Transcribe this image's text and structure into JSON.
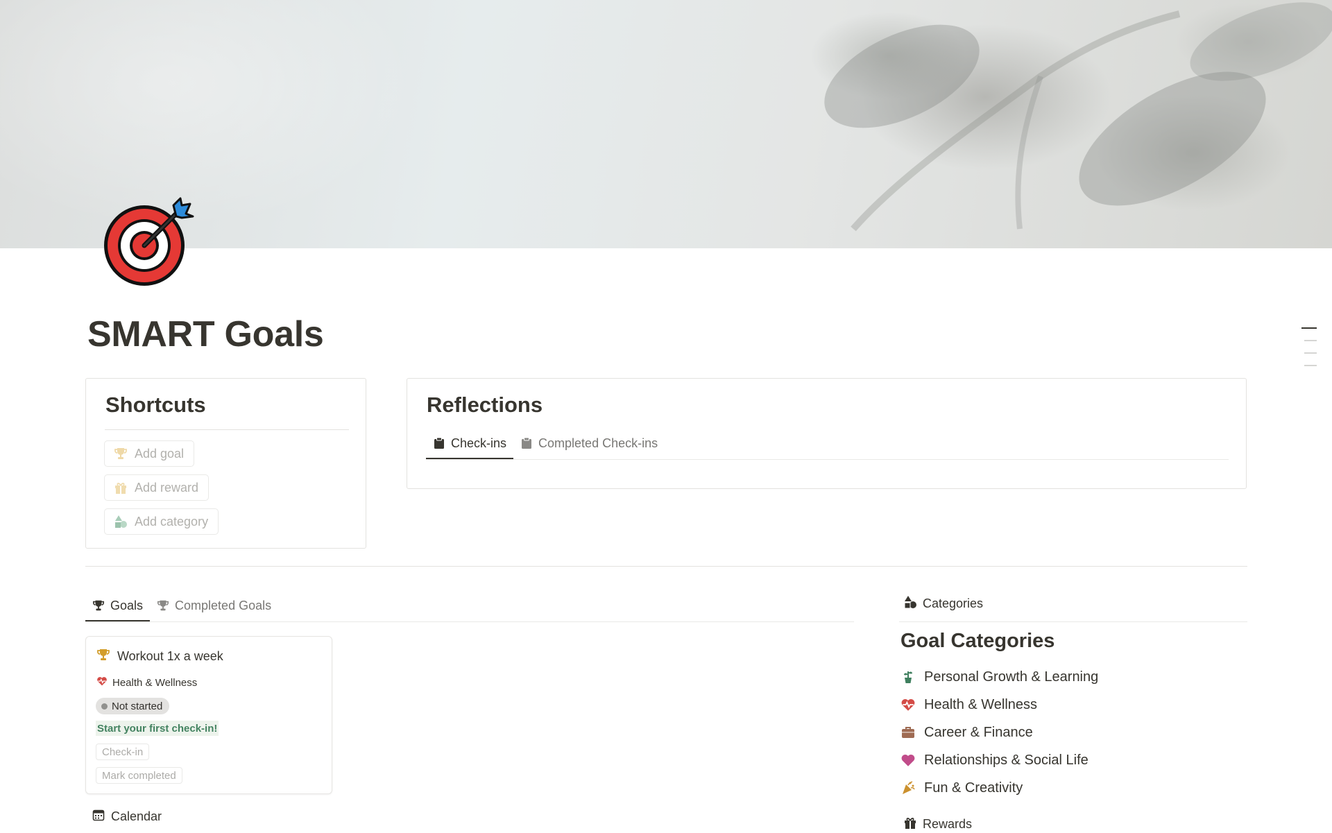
{
  "page": {
    "title": "SMART Goals",
    "icon": "direct-hit-target-icon"
  },
  "shortcuts": {
    "heading": "Shortcuts",
    "buttons": [
      {
        "label": "Add goal",
        "icon": "trophy-icon"
      },
      {
        "label": "Add reward",
        "icon": "gift-icon"
      },
      {
        "label": "Add category",
        "icon": "shapes-icon"
      }
    ]
  },
  "reflections": {
    "heading": "Reflections",
    "tabs": [
      {
        "label": "Check-ins",
        "icon": "clipboard-icon",
        "active": true
      },
      {
        "label": "Completed Check-ins",
        "icon": "clipboard-icon",
        "active": false
      }
    ]
  },
  "goals": {
    "tabs": [
      {
        "label": "Goals",
        "icon": "trophy-icon",
        "active": true
      },
      {
        "label": "Completed Goals",
        "icon": "trophy-icon",
        "active": false
      }
    ],
    "cards": [
      {
        "title": "Workout 1x a week",
        "category": "Health & Wellness",
        "status": "Not started",
        "prompt": "Start your first check-in!",
        "checkin_button": "Check-in",
        "complete_button": "Mark completed"
      }
    ],
    "calendar_label": "Calendar"
  },
  "categories": {
    "tab_label": "Categories",
    "heading": "Goal Categories",
    "items": [
      {
        "label": "Personal Growth & Learning",
        "icon": "potted-plant-icon"
      },
      {
        "label": "Health & Wellness",
        "icon": "heart-pulse-icon"
      },
      {
        "label": "Career & Finance",
        "icon": "briefcase-icon"
      },
      {
        "label": "Relationships & Social Life",
        "icon": "heart-icon"
      },
      {
        "label": "Fun & Creativity",
        "icon": "party-popper-icon"
      }
    ],
    "rewards_label": "Rewards"
  },
  "colors": {
    "text": "#37352f",
    "muted": "#787774",
    "status_green_text": "#448361",
    "status_green_bg": "#edf3ec",
    "status_gray_bg": "#e3e2e0",
    "target_red": "#e53935",
    "dart_blue": "#2d8cdb"
  }
}
